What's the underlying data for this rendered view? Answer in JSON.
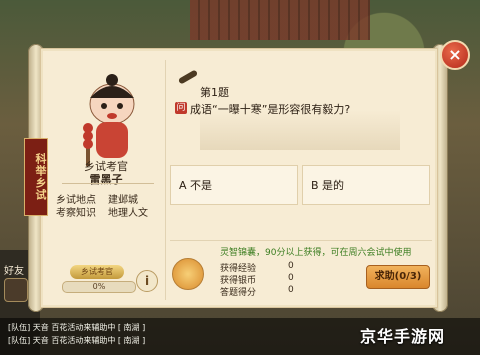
{
  "panel": {
    "close_label": "×",
    "ribbon_label": "科举乡试",
    "left": {
      "examiner_title": "乡试考官",
      "examiner_name": "雷黑子",
      "info": [
        {
          "key": "乡试地点",
          "value": "建邺城"
        },
        {
          "key": "考察知识",
          "value": "地理人文"
        }
      ],
      "medal_label": "乡试考官",
      "progress_text": "0%",
      "info_button": "i"
    },
    "question": {
      "number": "第1题",
      "tag": "问",
      "text": "成语“一曝十寒”是形容很有毅力?",
      "options": [
        {
          "label": "A 不是"
        },
        {
          "label": "B 是的"
        }
      ]
    },
    "reward": {
      "note": "灵智锦囊，90分以上获得，可在周六会试中使用",
      "rows": [
        {
          "key": "获得经验",
          "value": "0"
        },
        {
          "key": "获得银币",
          "value": "0"
        },
        {
          "key": "答题得分",
          "value": "0"
        }
      ],
      "ask_button": "求助(0/3)"
    }
  },
  "hud": {
    "friend_label": "好友"
  },
  "chat": [
    "[队伍] 天音 百花活动来辅助中 [ 南湖 ]",
    "[队伍] 天音 百花活动来辅助中 [ 南湖 ]"
  ],
  "watermark": "京华手游网",
  "colors": {
    "accent_green": "#3b7d20",
    "button_orange": "#d9862c",
    "close_red": "#b4281a"
  }
}
